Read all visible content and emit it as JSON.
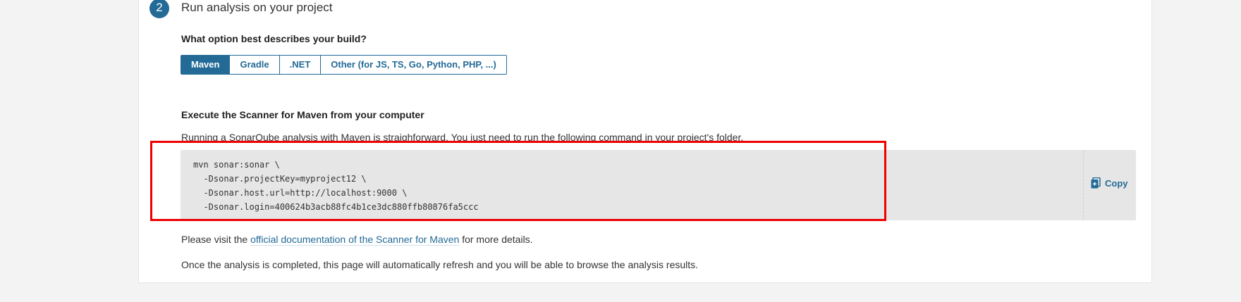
{
  "step": {
    "number": "2",
    "title": "Run analysis on your project"
  },
  "build_question": "What option best describes your build?",
  "build_options": [
    {
      "label": "Maven",
      "selected": true
    },
    {
      "label": "Gradle",
      "selected": false
    },
    {
      "label": ".NET",
      "selected": false
    },
    {
      "label": "Other (for JS, TS, Go, Python, PHP, ...)",
      "selected": false
    }
  ],
  "scanner": {
    "title": "Execute the Scanner for Maven from your computer",
    "intro": "Running a SonarQube analysis with Maven is straighforward. You just need to run the following command in your project's folder.",
    "command": "mvn sonar:sonar \\\n  -Dsonar.projectKey=myproject12 \\\n  -Dsonar.host.url=http://localhost:9000 \\\n  -Dsonar.login=400624b3acb88fc4b1ce3dc880ffb80876fa5ccc",
    "copy_label": "Copy",
    "copy_icon": "copy-icon"
  },
  "docs": {
    "before": "Please visit the ",
    "link": "official documentation of the Scanner for Maven",
    "after": " for more details."
  },
  "completion_note": "Once the analysis is completed, this page will automatically refresh and you will be able to browse the analysis results.",
  "colors": {
    "accent": "#236a97",
    "highlight": "#ee0000",
    "code_bg": "#e6e6e6"
  }
}
